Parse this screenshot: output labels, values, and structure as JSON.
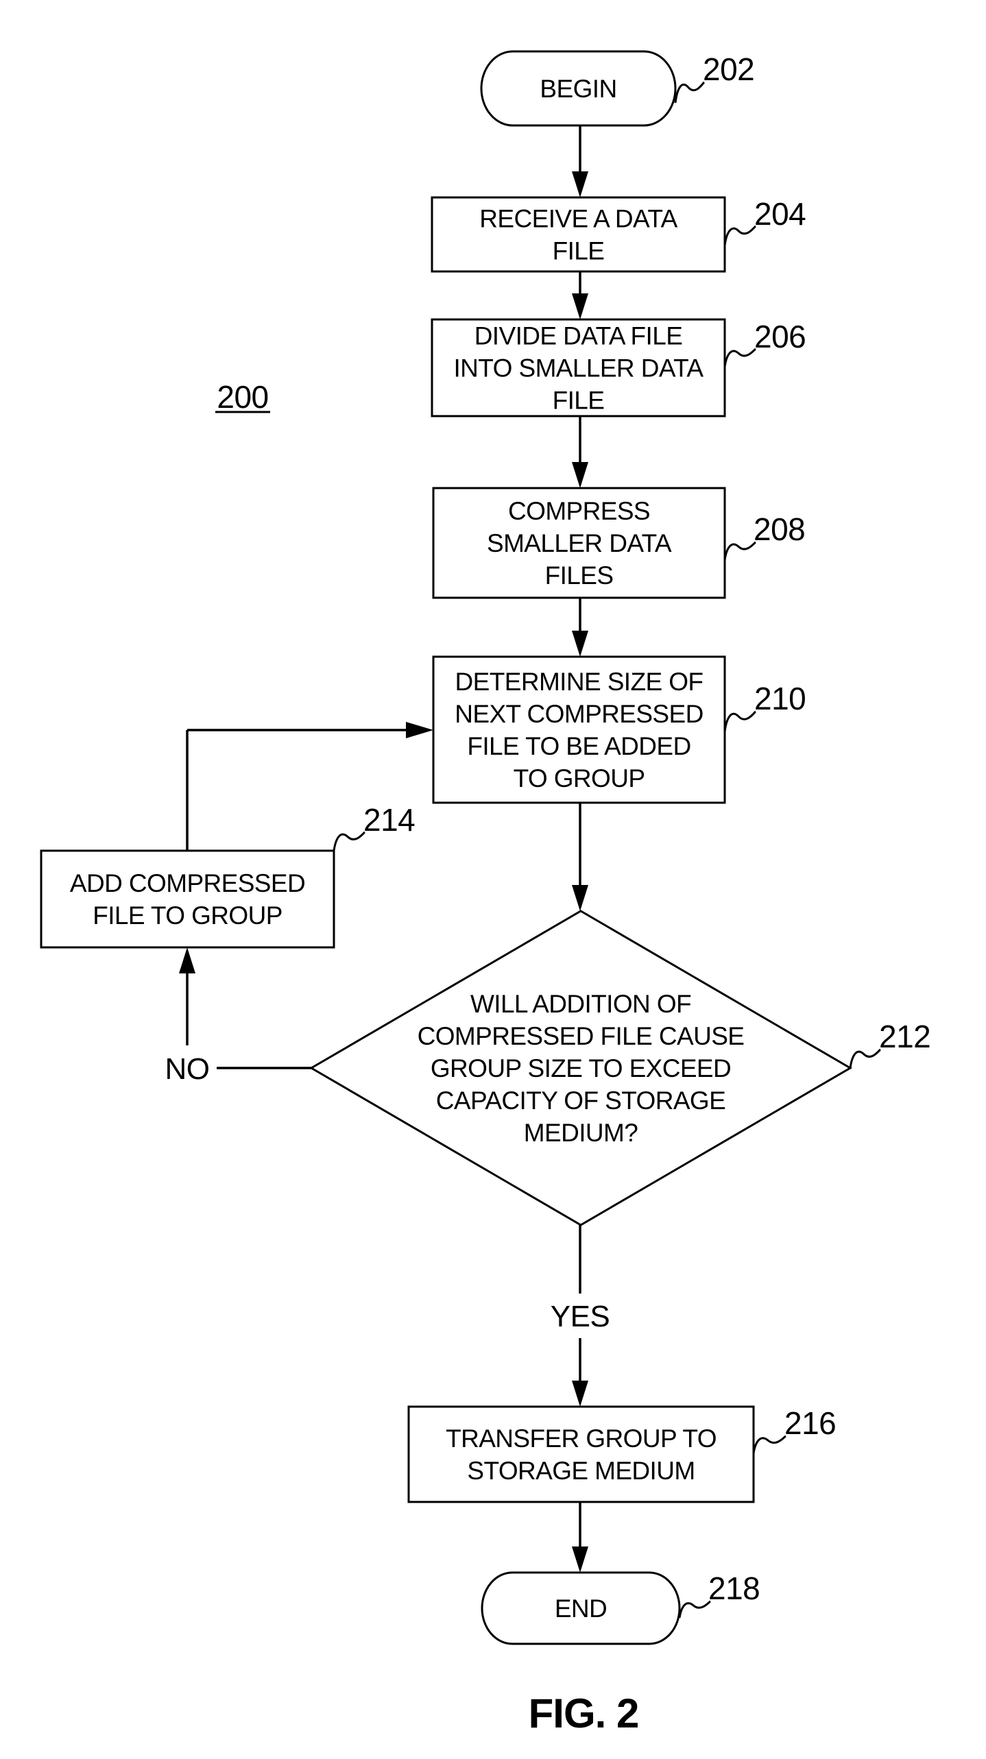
{
  "figure": {
    "diagram_ref": "200",
    "caption": "FIG. 2"
  },
  "nodes": [
    {
      "id": "202",
      "type": "terminal",
      "ref": "202",
      "lines": [
        "BEGIN"
      ]
    },
    {
      "id": "204",
      "type": "process",
      "ref": "204",
      "lines": [
        "RECEIVE A DATA",
        "FILE"
      ]
    },
    {
      "id": "206",
      "type": "process",
      "ref": "206",
      "lines": [
        "DIVIDE DATA FILE",
        "INTO SMALLER DATA",
        "FILE"
      ]
    },
    {
      "id": "208",
      "type": "process",
      "ref": "208",
      "lines": [
        "COMPRESS",
        "SMALLER DATA",
        "FILES"
      ]
    },
    {
      "id": "210",
      "type": "process",
      "ref": "210",
      "lines": [
        "DETERMINE SIZE OF",
        "NEXT COMPRESSED",
        "FILE TO BE ADDED",
        "TO GROUP"
      ]
    },
    {
      "id": "212",
      "type": "decision",
      "ref": "212",
      "lines": [
        "WILL ADDITION OF",
        "COMPRESSED FILE CAUSE",
        "GROUP SIZE TO EXCEED",
        "CAPACITY OF STORAGE",
        "MEDIUM?"
      ]
    },
    {
      "id": "214",
      "type": "process",
      "ref": "214",
      "lines": [
        "ADD COMPRESSED",
        "FILE TO GROUP"
      ]
    },
    {
      "id": "216",
      "type": "process",
      "ref": "216",
      "lines": [
        "TRANSFER GROUP TO",
        "STORAGE MEDIUM"
      ]
    },
    {
      "id": "218",
      "type": "terminal",
      "ref": "218",
      "lines": [
        "END"
      ]
    }
  ],
  "edges": [
    {
      "from": "202",
      "to": "204",
      "label": ""
    },
    {
      "from": "204",
      "to": "206",
      "label": ""
    },
    {
      "from": "206",
      "to": "208",
      "label": ""
    },
    {
      "from": "208",
      "to": "210",
      "label": ""
    },
    {
      "from": "210",
      "to": "212",
      "label": ""
    },
    {
      "from": "212",
      "to": "214",
      "label": "NO"
    },
    {
      "from": "214",
      "to": "210",
      "label": ""
    },
    {
      "from": "212",
      "to": "216",
      "label": "YES"
    },
    {
      "from": "216",
      "to": "218",
      "label": ""
    }
  ]
}
